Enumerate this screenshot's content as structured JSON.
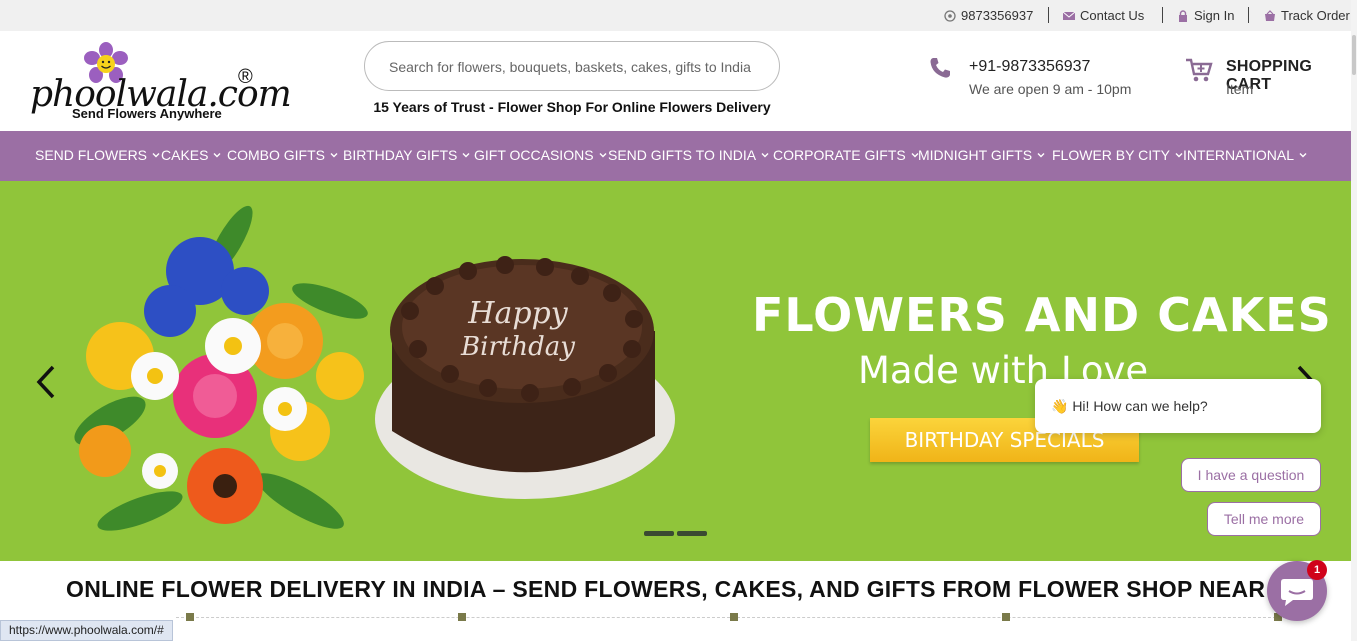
{
  "topbar": {
    "whatsapp": "9873356937",
    "contact": "Contact Us",
    "signin": "Sign In",
    "track": "Track Order"
  },
  "logo": {
    "word": "phoolwala.com",
    "reg": "®",
    "tagline": "Send Flowers Anywhere"
  },
  "search": {
    "placeholder": "Search for flowers, bouquets, baskets, cakes, gifts to India"
  },
  "trust_text": "15 Years of Trust - Flower Shop For Online Flowers Delivery",
  "contact": {
    "phone": "+91-9873356937",
    "hours": "We are open 9 am - 10pm"
  },
  "cart": {
    "title": "SHOPPING CART",
    "count_label": "Item"
  },
  "nav": {
    "items": [
      "SEND FLOWERS",
      "CAKES",
      "COMBO GIFTS",
      "BIRTHDAY GIFTS",
      "GIFT OCCASIONS",
      "SEND GIFTS TO INDIA",
      "CORPORATE GIFTS",
      "MIDNIGHT GIFTS",
      "FLOWER BY CITY",
      "INTERNATIONAL"
    ]
  },
  "banner": {
    "title": "FLOWERS AND CAKES",
    "subtitle": "Made with Love",
    "button": "BIRTHDAY SPECIALS",
    "cake_text_1": "Happy",
    "cake_text_2": "Birthday",
    "bg_color": "#90c53a"
  },
  "heading": "ONLINE FLOWER DELIVERY IN INDIA – SEND FLOWERS, CAKES, AND GIFTS FROM FLOWER SHOP NEAR YOU",
  "chat": {
    "greeting": "👋 Hi! How can we help?",
    "option1": "I have a question",
    "option2": "Tell me more",
    "badge": "1"
  },
  "status_url": "https://www.phoolwala.com/#",
  "colors": {
    "brand_purple": "#9b6fa4",
    "banner_green": "#90c53a",
    "button_yellow": "#f3be22"
  }
}
